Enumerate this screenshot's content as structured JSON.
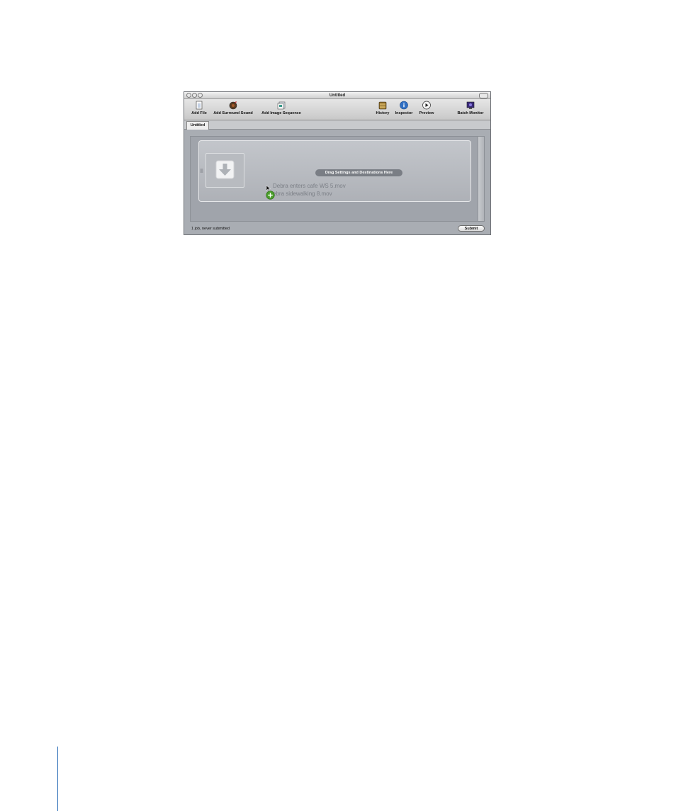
{
  "window": {
    "title": "Untitled"
  },
  "toolbar": {
    "left_items": [
      {
        "label": "Add File",
        "icon": "add-file-icon"
      },
      {
        "label": "Add Surround Sound",
        "icon": "surround-sound-icon"
      },
      {
        "label": "Add Image Sequence",
        "icon": "image-sequence-icon"
      }
    ],
    "right_items": [
      {
        "label": "History",
        "icon": "history-icon"
      },
      {
        "label": "Inspector",
        "icon": "info-icon"
      },
      {
        "label": "Preview",
        "icon": "play-icon"
      },
      {
        "label": "Batch Monitor",
        "icon": "batch-monitor-icon"
      }
    ]
  },
  "tabs": [
    {
      "label": "Untitled",
      "selected": true
    }
  ],
  "job": {
    "drop_hint": "Drag Settings and Destinations Here",
    "files": [
      "Debra enters cafe WS 5.mov",
      "ebra sidewalking 8.mov"
    ]
  },
  "status": {
    "text": "1 job, never submitted"
  },
  "submit_button": {
    "label": "Submit"
  },
  "colors": {
    "window_bg": "#a9adb3",
    "inspector_blue": "#2f6fc4",
    "drag_add_green": "#4a9d2a"
  }
}
